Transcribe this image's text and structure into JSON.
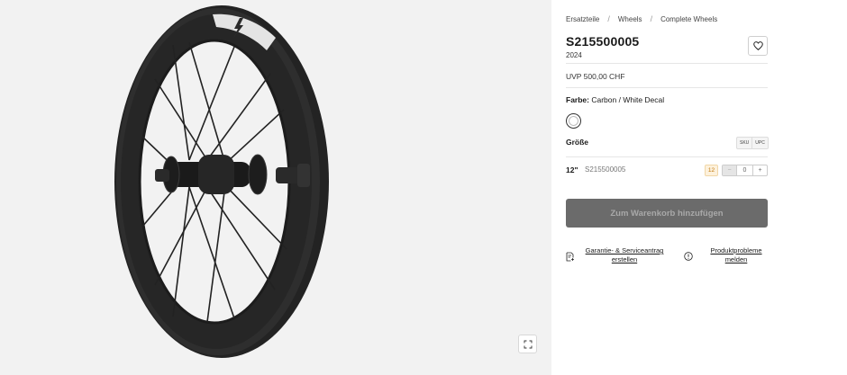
{
  "breadcrumb": [
    "Ersatzteile",
    "Wheels",
    "Complete Wheels"
  ],
  "breadcrumb_separator": "/",
  "product": {
    "title": "S215500005",
    "year": "2024",
    "price": "UVP 500,00 CHF"
  },
  "color": {
    "label": "Farbe:",
    "value": "Carbon / White Decal"
  },
  "size": {
    "label": "Größe",
    "toggle": [
      "SKU",
      "UPC"
    ],
    "rows": [
      {
        "size": "12\"",
        "sku": "S215500005",
        "stock": "12",
        "quantity": "0",
        "minus": "−",
        "plus": "+"
      }
    ]
  },
  "cart_button": "Zum Warenkorb hinzufügen",
  "links": {
    "warranty": "Garantie- & Serviceantrag erstellen",
    "problems": "Produktprobleme melden"
  },
  "icons": {
    "wishlist": "heart-icon",
    "expand": "expand-icon",
    "warranty": "document-plus-icon",
    "problems": "info-circle-icon"
  },
  "colors": {
    "cart_bg": "#6b6b6b",
    "stock_badge": "#fdf1dc",
    "gallery_bg": "#f2f2f2"
  }
}
